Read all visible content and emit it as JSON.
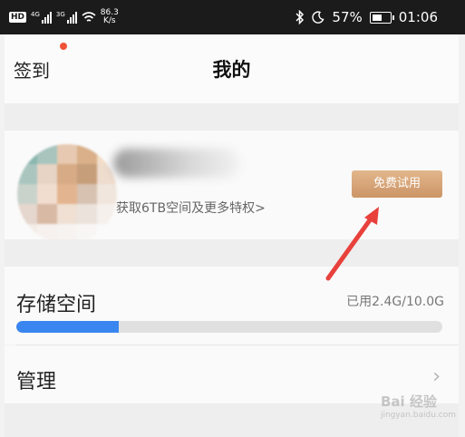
{
  "status_bar": {
    "hd": "HD",
    "network_1": "4G",
    "network_2": "3G",
    "speed_value": "86.3",
    "speed_unit": "K/s",
    "battery": "57%",
    "battery_level": 0.57,
    "time": "01:06",
    "icons": [
      "bluetooth-icon",
      "moon-icon",
      "battery-icon",
      "wifi-icon",
      "signal-icon"
    ]
  },
  "nav": {
    "checkin_label": "签到",
    "title": "我的"
  },
  "profile": {
    "benefit_text": "获取6TB空间及更多特权>",
    "trial_button": "免费试用"
  },
  "storage": {
    "label": "存储空间",
    "used_text": "已用2.4G/10.0G",
    "used_fraction": 0.24
  },
  "manage": {
    "label": "管理"
  },
  "watermark": {
    "text": "Bai 经验",
    "sub": "jingyan.baidu.com"
  },
  "colors": {
    "accent_blue": "#3a86f0",
    "trial_button": "#d9a47a",
    "red_dot": "#f0533a",
    "arrow": "#e8413c"
  }
}
